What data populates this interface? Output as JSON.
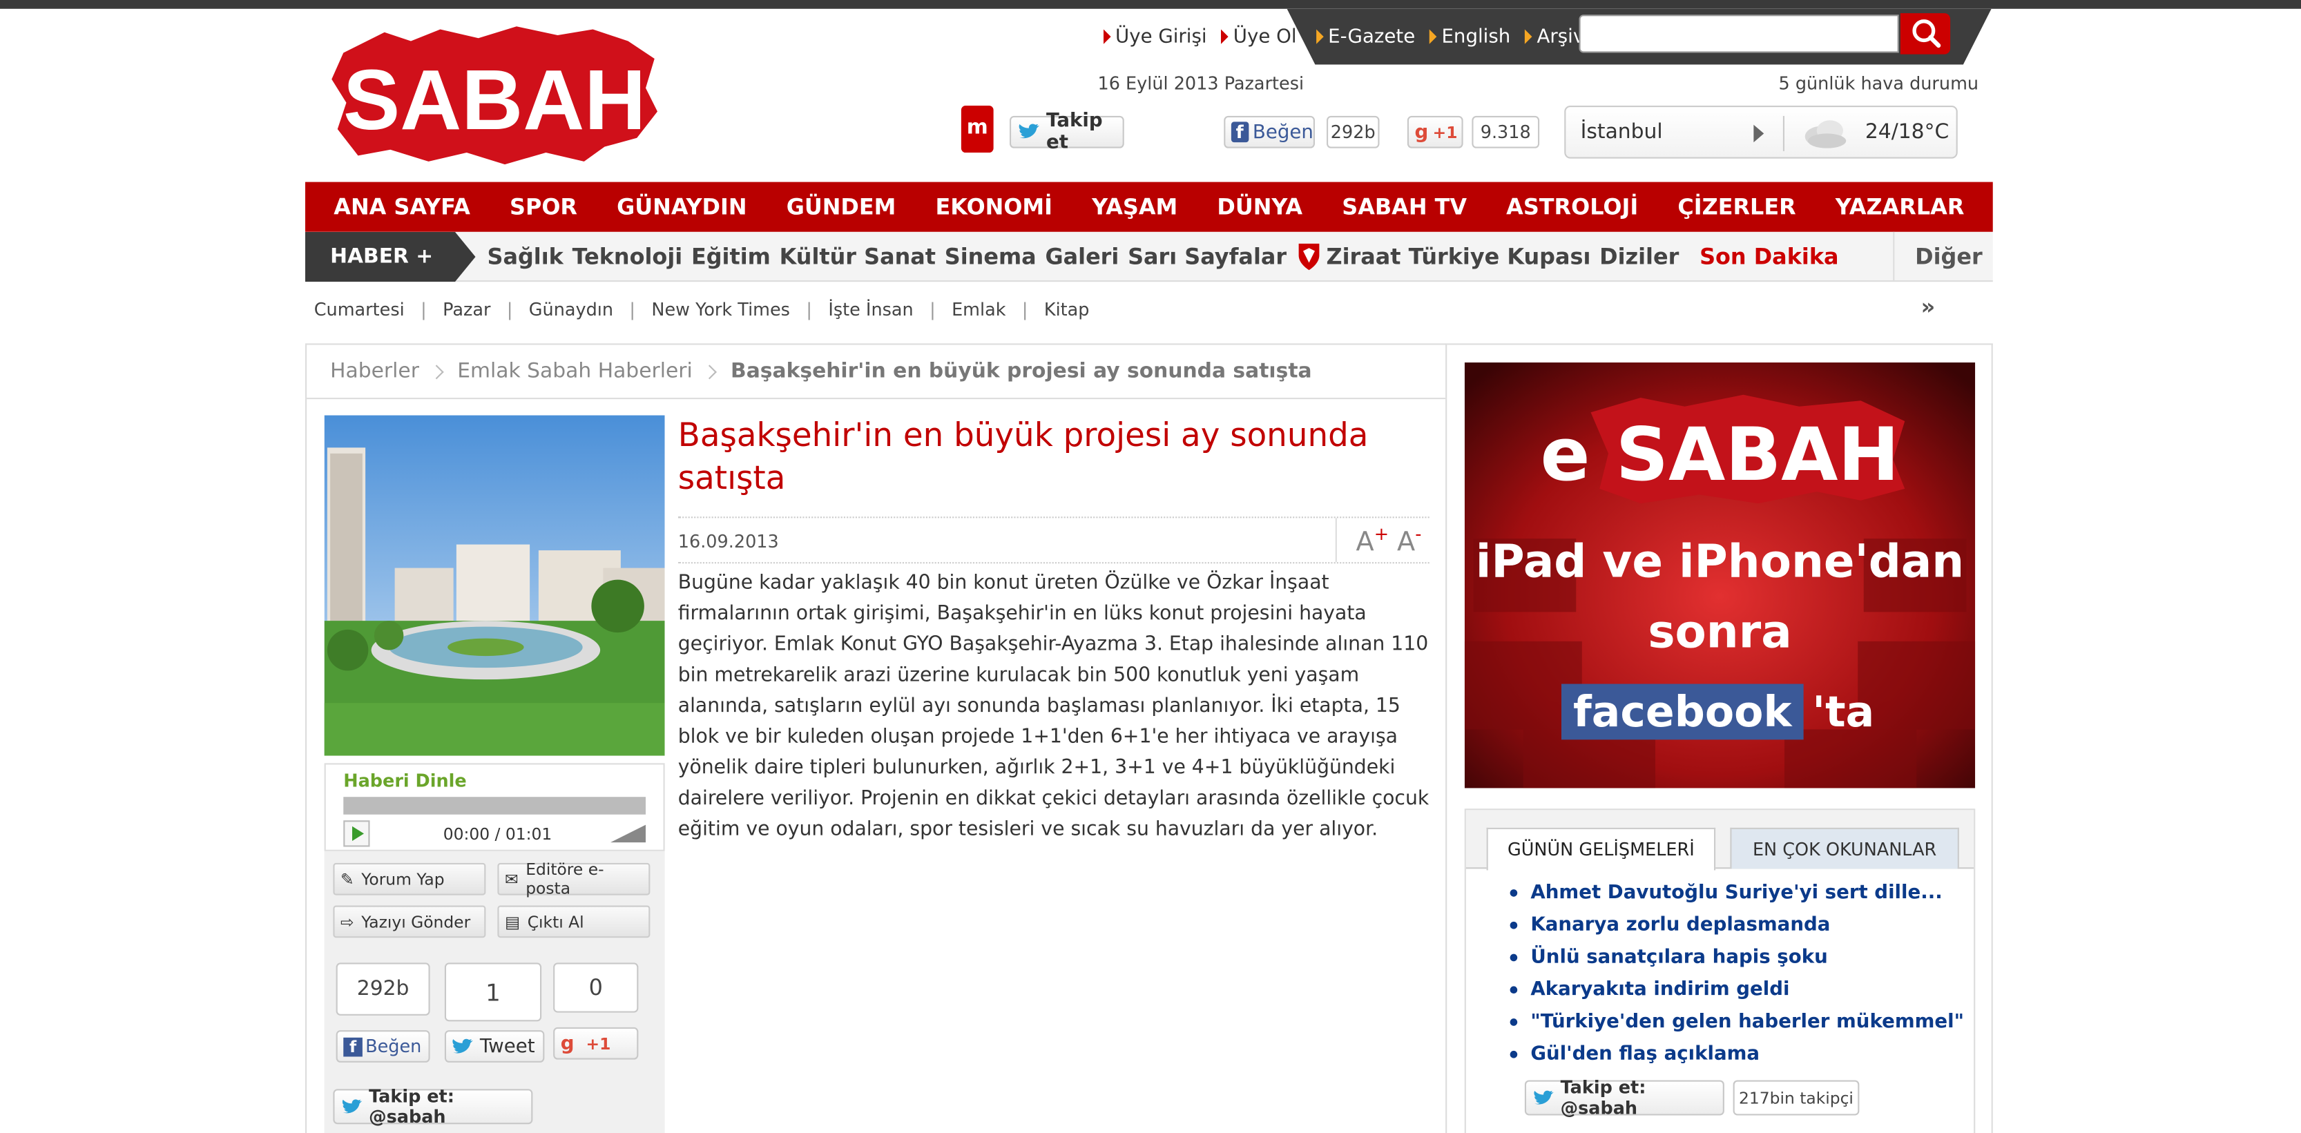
{
  "header": {
    "logo_text": "SABAH",
    "top_links": [
      "Üye Girişi",
      "Üye Ol"
    ],
    "dark_links": [
      "E-Gazete",
      "English",
      "Arşiv"
    ],
    "date": "16 Eylül 2013 Pazartesi",
    "weather_title": "5 günlük hava durumu",
    "social": {
      "twitter_follow": "Takip et",
      "fb_like": "Beğen",
      "fb_count": "292b",
      "gplus": "+1",
      "gplus_count": "9.318"
    },
    "weather": {
      "city": "İstanbul",
      "temp": "24/18°C"
    }
  },
  "nav": {
    "items": [
      "ANA SAYFA",
      "SPOR",
      "GÜNAYDIN",
      "GÜNDEM",
      "EKONOMİ",
      "YAŞAM",
      "DÜNYA",
      "SABAH TV",
      "ASTROLOJİ",
      "ÇİZERLER",
      "YAZARLAR"
    ]
  },
  "subnav": {
    "label": "HABER +",
    "items": [
      "Sağlık",
      "Teknoloji",
      "Eğitim",
      "Kültür Sanat",
      "Sinema",
      "Galeri",
      "Sarı Sayfalar",
      "Ziraat Türkiye Kupası",
      "Diziler"
    ],
    "breaking": "Son Dakika",
    "more": "Diğer"
  },
  "thirdnav": [
    "Cumartesi",
    "Pazar",
    "Günaydın",
    "New York Times",
    "İşte İnsan",
    "Emlak",
    "Kitap"
  ],
  "breadcrumb": [
    "Haberler",
    "Emlak Sabah Haberleri",
    "Başakşehir'in en büyük projesi ay sonunda satışta"
  ],
  "article": {
    "title": "Başakşehir'in en büyük projesi ay sonunda satışta",
    "date": "16.09.2013",
    "font_up": "A+",
    "font_down": "A-",
    "body": "Bugüne kadar yaklaşık 40 bin konut üreten Özülke ve Özkar İnşaat firmalarının ortak girişimi, Başakşehir'in en lüks konut projesini hayata geçiriyor. Emlak Konut GYO Başakşehir-Ayazma 3. Etap ihalesinde alınan 110 bin metrekarelik arazi üzerine kurulacak bin 500 konutluk yeni yaşam alanında, satışların eylül ayı sonunda başlaması planlanıyor. İki etapta, 15 blok ve bir kuleden oluşan projede 1+1'den 6+1'e her ihtiyaca ve arayışa yönelik daire tipleri bulunurken, ağırlık 2+1, 3+1 ve 4+1 büyüklüğündeki dairelere veriliyor. Projenin en dikkat çekici detayları arasında özellikle çocuk eğitim ve oyun odaları, spor tesisleri ve sıcak su havuzları da yer alıyor."
  },
  "player": {
    "title": "Haberi Dinle",
    "time": "00:00 / 01:01",
    "progress": 0
  },
  "tools": {
    "comment": "Yorum Yap",
    "email": "Editöre e-posta",
    "send": "Yazıyı Gönder",
    "print": "Çıktı Al",
    "fb_count": "292b",
    "tw_count": "1",
    "gp_count": "0",
    "fb_label": "Beğen",
    "tw_label": "Tweet",
    "gp_label": "+1",
    "follow": "Takip et: @sabah"
  },
  "ad": {
    "line1": "e SABAH",
    "line2": "iPad ve iPhone'dan",
    "line3": "sonra",
    "line4a": "facebook",
    "line4b": "'ta"
  },
  "tabs": {
    "tab1": "GÜNÜN GELİŞMELERİ",
    "tab2": "EN ÇOK OKUNANLAR",
    "items": [
      "Ahmet Davutoğlu Suriye'yi sert dille...",
      "Kanarya zorlu deplasmanda",
      "Ünlü sanatçılara hapis şoku",
      "Akaryakıta indirim geldi",
      "\"Türkiye'den gelen haberler mükemmel\"",
      "Gül'den flaş açıklama"
    ],
    "follow": "Takip et: @sabah",
    "followers": "217bin takipçi"
  },
  "colors": {
    "brand": "#b90000",
    "headline": "#c10000",
    "link": "#0b3a8a",
    "dark": "#3a3a3a"
  }
}
